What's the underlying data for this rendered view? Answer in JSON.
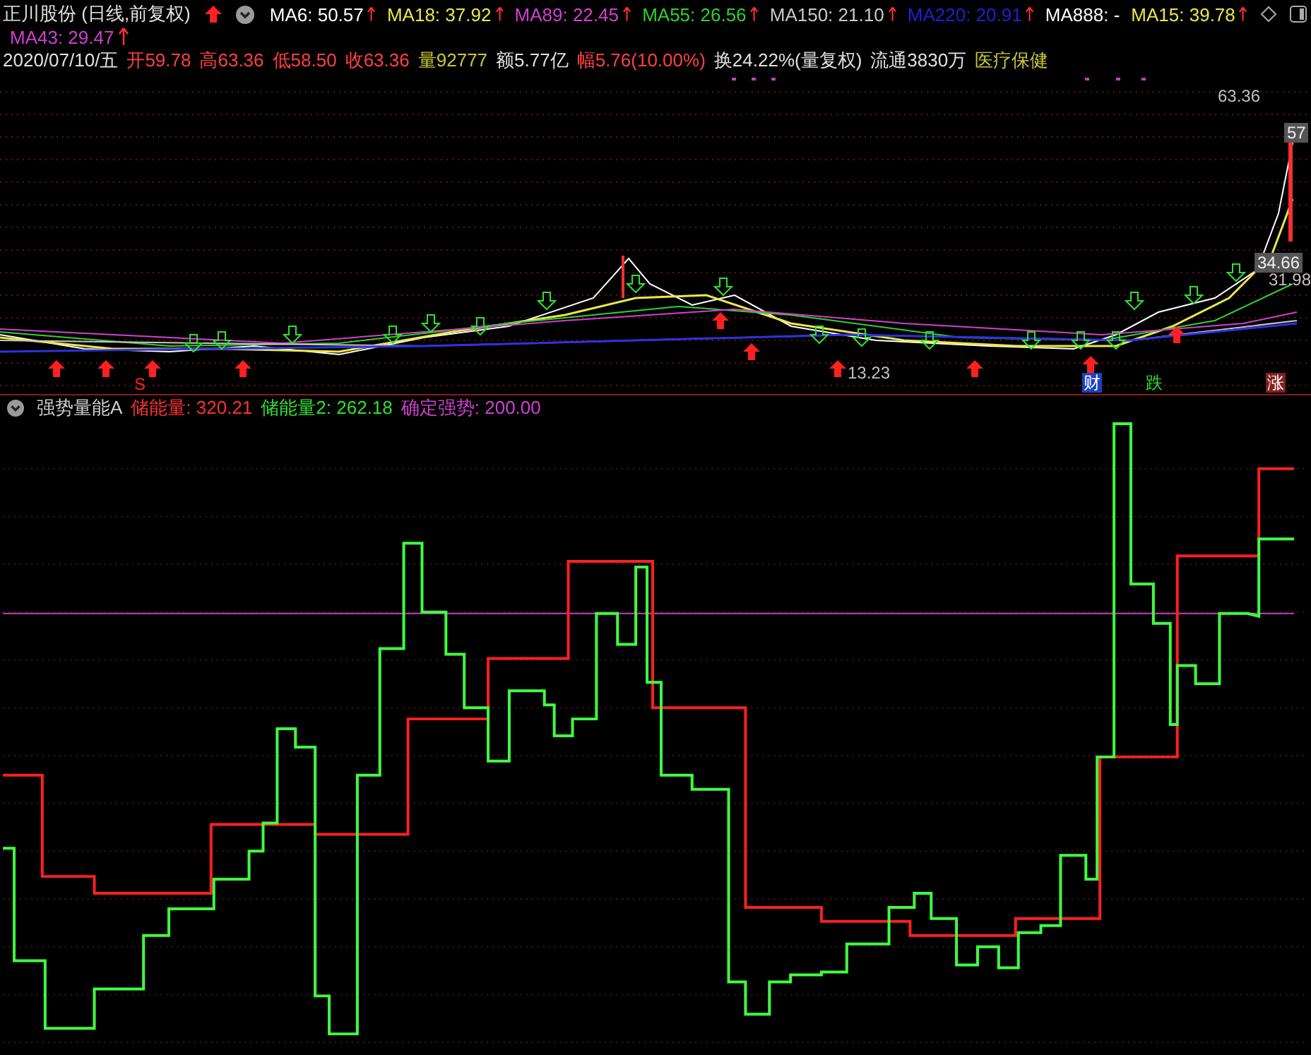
{
  "title": "正川股份 (日线,前复权)",
  "ma_rows": [
    [
      {
        "label": "MA6: 50.57",
        "color": "#ffffff",
        "arrow": true
      },
      {
        "label": "MA18: 37.92",
        "color": "#e8e84a",
        "arrow": true
      },
      {
        "label": "MA89: 22.45",
        "color": "#d040d0",
        "arrow": true
      },
      {
        "label": "MA55: 26.56",
        "color": "#30d030",
        "arrow": true
      },
      {
        "label": "MA150: 21.10",
        "color": "#c8c8c8",
        "arrow": true
      },
      {
        "label": "MA220: 20.91",
        "color": "#2020d0",
        "arrow": true
      },
      {
        "label": "MA888: -",
        "color": "#ffffff",
        "arrow": false
      },
      {
        "label": "MA15: 39.78",
        "color": "#e8e84a",
        "arrow": true
      }
    ],
    [
      {
        "label": "MA43: 29.47",
        "color": "#d040d0",
        "arrow": true
      }
    ]
  ],
  "quote": [
    {
      "text": "2020/07/10/五",
      "color": "#e0e0e0"
    },
    {
      "text": "开59.78",
      "color": "#ff4040"
    },
    {
      "text": "高63.36",
      "color": "#ff4040"
    },
    {
      "text": "低58.50",
      "color": "#ff4040"
    },
    {
      "text": "收63.36",
      "color": "#ff4040"
    },
    {
      "text": "量92777",
      "color": "#c8c83c"
    },
    {
      "text": "额5.77亿",
      "color": "#e0e0e0"
    },
    {
      "text": "幅5.76(10.00%)",
      "color": "#ff4040"
    },
    {
      "text": "换24.22%(量复权)",
      "color": "#e0e0e0"
    },
    {
      "text": "流通3830万",
      "color": "#e0e0e0"
    },
    {
      "text": "医疗保健",
      "color": "#c8c83c"
    }
  ],
  "chart_labels": [
    {
      "text": "63.36",
      "kind": "price"
    },
    {
      "text": "57",
      "kind": "box"
    },
    {
      "text": "34.66",
      "kind": "box"
    },
    {
      "text": "31.98",
      "kind": "price"
    },
    {
      "text": "13.23",
      "kind": "price"
    }
  ],
  "events": [
    {
      "text": "S",
      "kind": "red-text"
    },
    {
      "text": "财",
      "kind": "blue-tag"
    },
    {
      "text": "跌",
      "kind": "green-text"
    },
    {
      "text": "涨",
      "kind": "red-tag"
    }
  ],
  "indicator": {
    "name": "强势量能A",
    "values": [
      {
        "label": "储能量: 320.21",
        "color": "#ff3030"
      },
      {
        "label": "储能量2: 262.18",
        "color": "#30e030"
      },
      {
        "label": "确定强势: 200.00",
        "color": "#d040d0"
      }
    ]
  }
}
